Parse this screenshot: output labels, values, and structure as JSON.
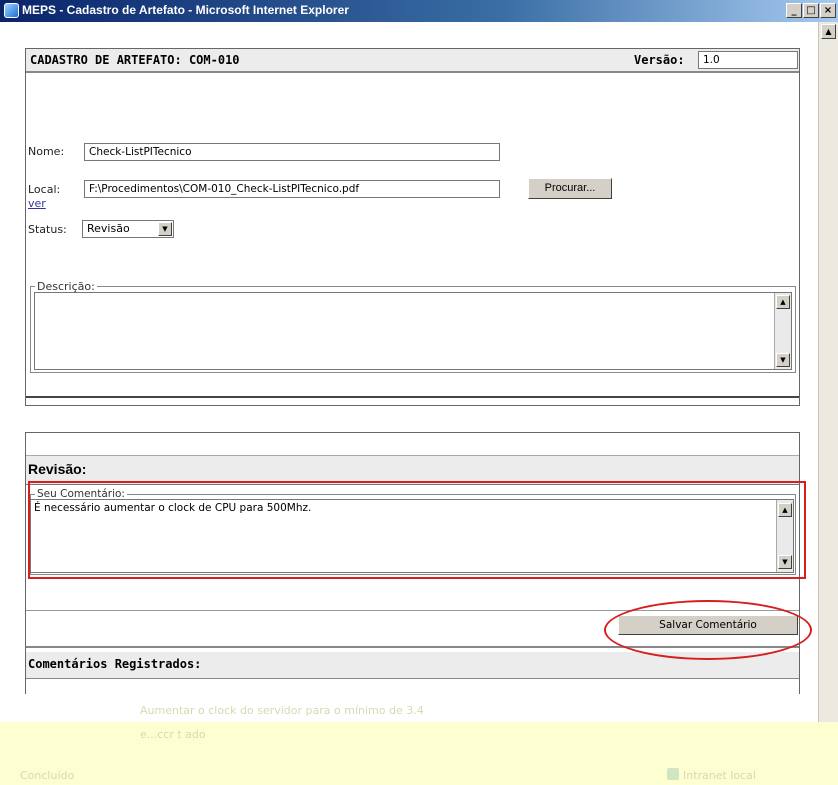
{
  "window": {
    "title": "MEPS - Cadastro de Artefato - Microsoft Internet Explorer",
    "minimize_glyph": "_",
    "maximize_glyph": "□",
    "close_glyph": "×"
  },
  "form": {
    "header": "CADASTRO DE ARTEFATO: COM-010",
    "version_label": "Versão:",
    "version_value": "1.0",
    "nome_label": "Nome:",
    "nome_value": "Check-ListPITecnico",
    "local_label": "Local:",
    "local_value": "F:\\Procedimentos\\COM-010_Check-ListPITecnico.pdf",
    "browse_button": "Procurar...",
    "ver_link": "ver",
    "status_label": "Status:",
    "status_value": "Revisão",
    "descricao_legend": "Descrição:",
    "descricao_value": ""
  },
  "review": {
    "header": "Revisão:",
    "comment_legend": "Seu Comentário:",
    "comment_value": "É necessário aumentar o clock de CPU para 500Mhz.",
    "save_button": "Salvar Comentário",
    "registered_header": "Comentários Registrados:",
    "registered_row_1": "Aumentar o clock do servidor para o mínimo de 3.4",
    "registered_row_2": "e...ccr t ado"
  },
  "statusbar": {
    "left_text": "Concluído",
    "right_text": "Intranet local"
  },
  "colors": {
    "annotation": "#d62020",
    "titlebar": "#0a246a",
    "statusbar": "#fdffd0"
  }
}
